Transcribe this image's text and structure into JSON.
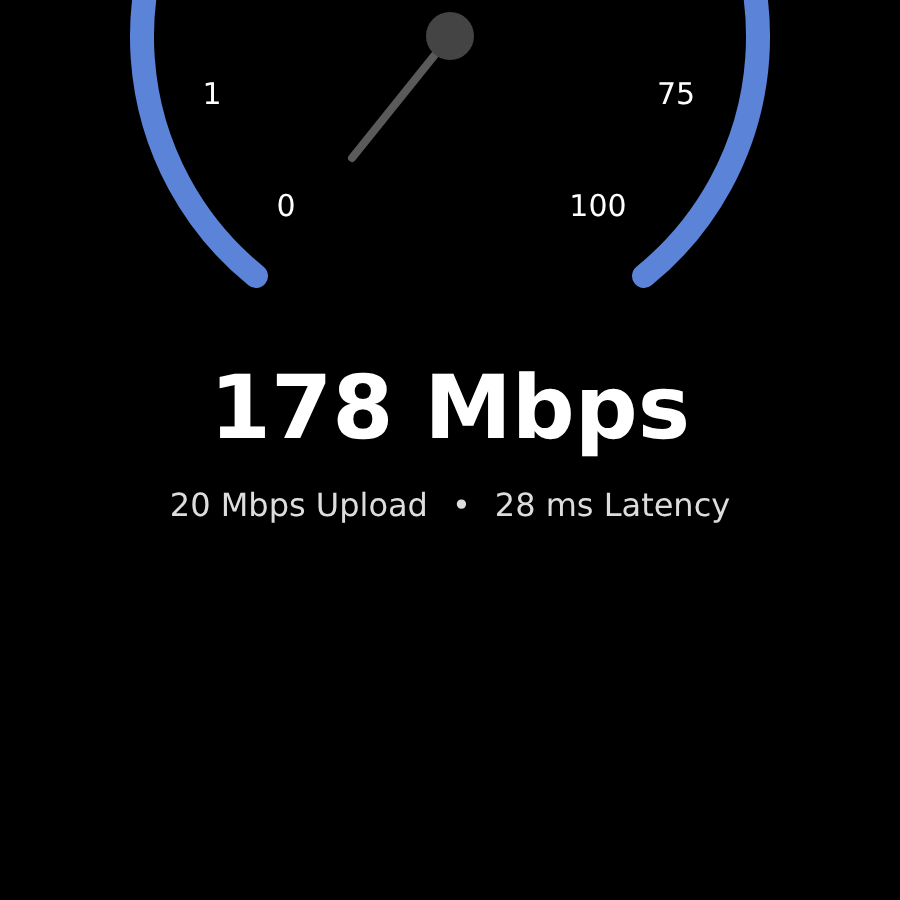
{
  "gauge": {
    "labels": [
      "1",
      "75",
      "0",
      "100"
    ]
  },
  "speed": "178 Mbps",
  "stats": {
    "upload": "20 Mbps Upload",
    "separator": "•",
    "latency": "28 ms Latency"
  }
}
